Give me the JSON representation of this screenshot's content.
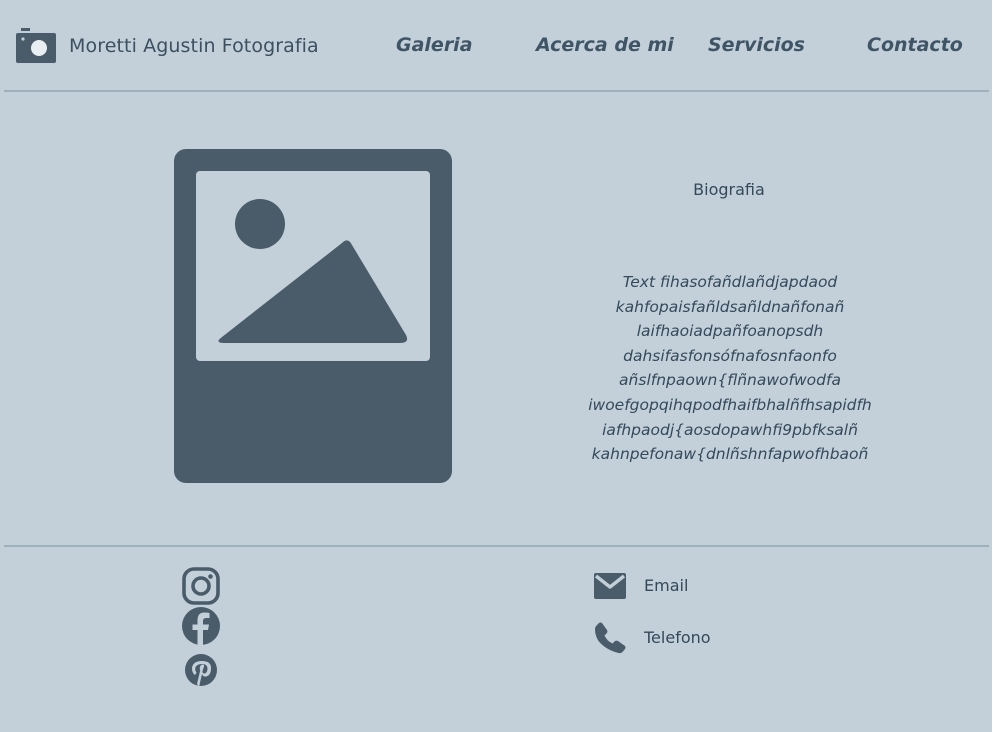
{
  "header": {
    "brand": "Moretti Agustin Fotografia",
    "nav": [
      "Galeria",
      "Acerca de mi",
      "Servicios",
      "Contacto"
    ]
  },
  "main": {
    "image_placeholder_icon": "image-placeholder-icon",
    "bio_title": "Biografia",
    "bio_lines": [
      "Text fihasofañdlañdjapdaod",
      "kahfopaisfañldsañldnañfonañ",
      "laifhaoiadpañfoanopsdh",
      "dahsifasfonsófnafosnfaonfo",
      "añslfnpaown{flñnawofwodfa",
      "iwoefgopqihqpodfhaifbhalñfhsapidfh",
      "iafhpaodj{aosdopawhfi9pbfksalñ",
      "kahnpefonaw{dnlñshnfapwofhbaoñ"
    ]
  },
  "footer": {
    "social_icons": [
      "instagram-icon",
      "facebook-icon",
      "pinterest-icon"
    ],
    "contacts": [
      {
        "icon": "email-icon",
        "label": "Email"
      },
      {
        "icon": "phone-icon",
        "label": "Telefono"
      }
    ]
  },
  "colors": {
    "background": "#c3d0d9",
    "primary_dark": "#4a5c6a",
    "divider": "#9fb0bd"
  }
}
